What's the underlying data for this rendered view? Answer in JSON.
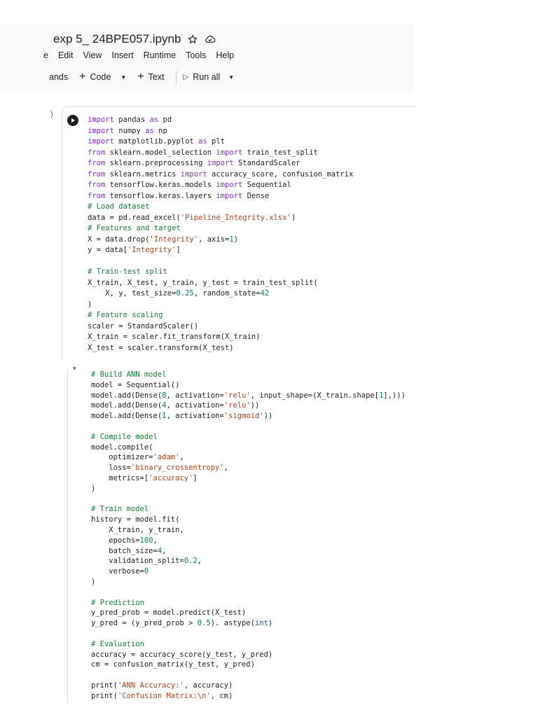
{
  "header": {
    "title": "exp 5_ 24BPE057.ipynb",
    "star_icon": "star-icon",
    "cloud_icon": "cloud-saved-icon",
    "menu": [
      "e",
      "Edit",
      "View",
      "Insert",
      "Runtime",
      "Tools",
      "Help"
    ],
    "toolbar": {
      "commands": "ands",
      "code": "Code",
      "text": "Text",
      "run_all": "Run all"
    }
  },
  "cell1": {
    "gutter_mark": ")",
    "lines": [
      [
        [
          "kw",
          "import"
        ],
        [
          "t",
          " pandas "
        ],
        [
          "kw",
          "as"
        ],
        [
          "t",
          " pd"
        ]
      ],
      [
        [
          "kw",
          "import"
        ],
        [
          "t",
          " numpy "
        ],
        [
          "kw",
          "as"
        ],
        [
          "t",
          " np"
        ]
      ],
      [
        [
          "kw",
          "import"
        ],
        [
          "t",
          " matplotlib.pyplot "
        ],
        [
          "kw",
          "as"
        ],
        [
          "t",
          " plt"
        ]
      ],
      [
        [
          "kw",
          "from"
        ],
        [
          "t",
          " sklearn.model_selection "
        ],
        [
          "kw",
          "import"
        ],
        [
          "t",
          " train_test_split"
        ]
      ],
      [
        [
          "kw",
          "from"
        ],
        [
          "t",
          " sklearn.preprocessing "
        ],
        [
          "kw",
          "import"
        ],
        [
          "t",
          " StandardScaler"
        ]
      ],
      [
        [
          "kw",
          "from"
        ],
        [
          "t",
          " sklearn.metrics "
        ],
        [
          "kw",
          "import"
        ],
        [
          "t",
          " accuracy_score, confusion_matrix"
        ]
      ],
      [
        [
          "kw",
          "from"
        ],
        [
          "t",
          " tensorflow.keras.models "
        ],
        [
          "kw",
          "import"
        ],
        [
          "t",
          " Sequential"
        ]
      ],
      [
        [
          "kw",
          "from"
        ],
        [
          "t",
          " tensorflow.keras.layers "
        ],
        [
          "kw",
          "import"
        ],
        [
          "t",
          " Dense"
        ]
      ],
      [
        [
          "com",
          "# Load dataset"
        ]
      ],
      [
        [
          "t",
          "data = pd.read_excel("
        ],
        [
          "str",
          "'Pipeline_Integrity.xlsx'"
        ],
        [
          "t",
          ")"
        ]
      ],
      [
        [
          "com",
          "# Features and target"
        ]
      ],
      [
        [
          "t",
          "X = data.drop("
        ],
        [
          "str",
          "'Integrity'"
        ],
        [
          "t",
          ", axis="
        ],
        [
          "num",
          "1"
        ],
        [
          "t",
          ")"
        ]
      ],
      [
        [
          "t",
          "y = data["
        ],
        [
          "str",
          "'Integrity'"
        ],
        [
          "t",
          "]"
        ]
      ],
      [],
      [
        [
          "com",
          "# Train-test split"
        ]
      ],
      [
        [
          "t",
          "X_train, X_test, y_train, y_test = train_test_split("
        ]
      ],
      [
        [
          "t",
          "    X, y, test_size="
        ],
        [
          "num",
          "0.25"
        ],
        [
          "t",
          ", random_state="
        ],
        [
          "num",
          "42"
        ]
      ],
      [
        [
          "t",
          ")"
        ]
      ],
      [
        [
          "com",
          "# Feature scaling"
        ]
      ],
      [
        [
          "t",
          "scaler = StandardScaler()"
        ]
      ],
      [
        [
          "t",
          "X_train = scaler.fit_transform(X_train)"
        ]
      ],
      [
        [
          "t",
          "X_test = scaler.transform(X_test)"
        ]
      ]
    ]
  },
  "cell2": {
    "lines": [
      [
        [
          "com",
          "# Build ANN model"
        ]
      ],
      [
        [
          "t",
          "model = Sequential()"
        ]
      ],
      [
        [
          "t",
          "model.add(Dense("
        ],
        [
          "num",
          "8"
        ],
        [
          "t",
          ", activation="
        ],
        [
          "str",
          "'relu'"
        ],
        [
          "t",
          ", input_shape=(X_train.shape["
        ],
        [
          "num",
          "1"
        ],
        [
          "t",
          "],)))"
        ]
      ],
      [
        [
          "t",
          "model.add(Dense("
        ],
        [
          "num",
          "4"
        ],
        [
          "t",
          ", activation="
        ],
        [
          "str",
          "'relu'"
        ],
        [
          "t",
          "))"
        ]
      ],
      [
        [
          "t",
          "model.add(Dense("
        ],
        [
          "num",
          "1"
        ],
        [
          "t",
          ", activation="
        ],
        [
          "str",
          "'sigmoid'"
        ],
        [
          "t",
          "))"
        ]
      ],
      [],
      [
        [
          "com",
          "# Compile model"
        ]
      ],
      [
        [
          "t",
          "model.compile("
        ]
      ],
      [
        [
          "t",
          "    optimizer="
        ],
        [
          "str",
          "'adam'"
        ],
        [
          "t",
          ","
        ]
      ],
      [
        [
          "t",
          "    loss="
        ],
        [
          "str",
          "'binary_crossentropy'"
        ],
        [
          "t",
          ","
        ]
      ],
      [
        [
          "t",
          "    metrics=["
        ],
        [
          "str",
          "'accuracy'"
        ],
        [
          "t",
          "]"
        ]
      ],
      [
        [
          "t",
          ")"
        ]
      ],
      [],
      [
        [
          "com",
          "# Train model"
        ]
      ],
      [
        [
          "t",
          "history = model.fit("
        ]
      ],
      [
        [
          "t",
          "    X_train, y_train,"
        ]
      ],
      [
        [
          "t",
          "    epochs="
        ],
        [
          "num",
          "100"
        ],
        [
          "t",
          ","
        ]
      ],
      [
        [
          "t",
          "    batch_size="
        ],
        [
          "num",
          "4"
        ],
        [
          "t",
          ","
        ]
      ],
      [
        [
          "t",
          "    validation_split="
        ],
        [
          "num",
          "0.2"
        ],
        [
          "t",
          ","
        ]
      ],
      [
        [
          "t",
          "    verbose="
        ],
        [
          "num",
          "0"
        ]
      ],
      [
        [
          "t",
          ")"
        ]
      ],
      [],
      [
        [
          "com",
          "# Prediction"
        ]
      ],
      [
        [
          "t",
          "y_pred_prob = model.predict(X_test)"
        ]
      ],
      [
        [
          "t",
          "y_pred = (y_pred_prob > "
        ],
        [
          "num",
          "0.5"
        ],
        [
          "t",
          "). astype("
        ],
        [
          "bi",
          "int"
        ],
        [
          "t",
          ")"
        ]
      ],
      [],
      [
        [
          "com",
          "# Evaluation"
        ]
      ],
      [
        [
          "t",
          "accuracy = accuracy_score(y_test, y_pred)"
        ]
      ],
      [
        [
          "t",
          "cm = confusion_matrix(y_test, y_pred)"
        ]
      ],
      [],
      [
        [
          "t",
          "print("
        ],
        [
          "str",
          "'ANN Accuracy:'"
        ],
        [
          "t",
          ", accuracy)"
        ]
      ],
      [
        [
          "t",
          "print("
        ],
        [
          "str",
          "'Confusion Matrix:\\n'"
        ],
        [
          "t",
          ", cm)"
        ]
      ]
    ]
  },
  "colors": {
    "keyword": "#8430ce",
    "string": "#b5451b",
    "number": "#098658",
    "comment": "#188038",
    "builtin": "#0b57d0"
  }
}
